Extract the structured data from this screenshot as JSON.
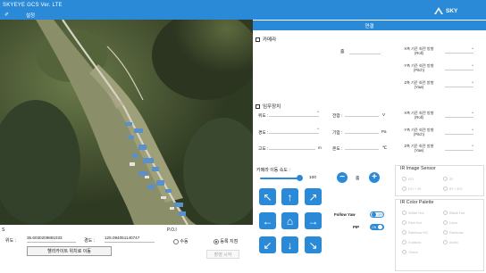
{
  "header": {
    "app_title": "SKYEYE GCS Ver. LTE",
    "menu_icon": "pencil-icon",
    "settings_label": "설정",
    "logo_text": "SKY"
  },
  "connect": {
    "label": "연결"
  },
  "camera": {
    "title": "카메라",
    "zoom_label": "줌",
    "roll_label": [
      "X축 기준 회전 방향",
      "(Roll)"
    ],
    "pitch_label": [
      "Y축 기준 회전 방향",
      "(Pitch)"
    ],
    "yaw_label": [
      "Z축 기준 회전 방향",
      "(Yaw)"
    ]
  },
  "mission": {
    "title": "임무장치",
    "lat_label": "위도 :",
    "lon_label": "경도 :",
    "alt_label": "고도 :",
    "alt_unit": "m",
    "voltage_label": "전압 :",
    "voltage_unit": "V",
    "pressure_label": "기압 :",
    "pressure_unit": "Pa",
    "temp_label": "온도 :",
    "temp_unit": "℃",
    "lat_value": "°",
    "lon_value": "°",
    "roll_label": [
      "X축 기준 회전 방향",
      "(Roll)"
    ],
    "pitch_label": [
      "Y축 기준 회전 방향",
      "(Pitch)"
    ],
    "yaw_label": [
      "Z축 기준 회전 방향",
      "(Yaw)"
    ]
  },
  "camera_move": {
    "title": "카메라 이동 속도 :",
    "speed_value": "100",
    "speed_fraction": 1.0,
    "zoom_label": "줌"
  },
  "toggles": {
    "follow_yaw_label": "Follow Yaw",
    "follow_yaw_text": "OFF",
    "pip_label": "PIP",
    "pip_text": "ON"
  },
  "ir_sensor": {
    "title": "IR Image Sensor",
    "options": [
      "EO",
      "EO + IR",
      "IR",
      "IR + EO"
    ]
  },
  "ir_palette": {
    "title": "IR Color Palette",
    "options": [
      "White Hot",
      "Black Hot",
      "Red Hot",
      "Lava",
      "Rainbow HC",
      "Rainbow",
      "Ironbow",
      "Arctic",
      "Globe"
    ]
  },
  "gps": {
    "title": "S",
    "lat_label": "위도 :",
    "lat_value": "35.6030209881033",
    "lon_label": "경도 :",
    "lon_value": "125.094051140747",
    "heli_button": "헬리카이트 위치로 이동"
  },
  "poi": {
    "title": "P.O.I",
    "option1": "수동",
    "option2": "등록 지점",
    "start_button": "촬영 시작"
  },
  "colors": {
    "accent": "#2b8ad8"
  }
}
